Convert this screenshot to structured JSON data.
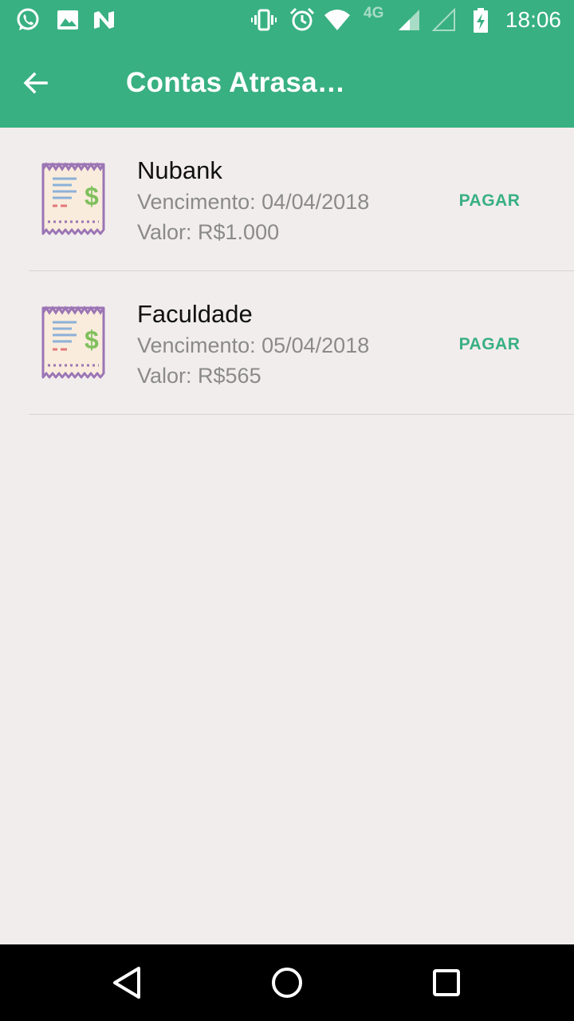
{
  "status_bar": {
    "network": "4G",
    "time": "18:06",
    "icons": [
      "whatsapp-icon",
      "gallery-icon",
      "n-app-icon",
      "vibrate-icon",
      "alarm-icon",
      "wifi-icon",
      "signal-icon",
      "signal-icon",
      "battery-charging-icon"
    ]
  },
  "app_bar": {
    "title": "Contas Atrasa…",
    "back_icon": "arrow-back-icon"
  },
  "bills": [
    {
      "name": "Nubank",
      "due": "Vencimento: 04/04/2018",
      "value": "Valor: R$1.000",
      "action": "PAGAR"
    },
    {
      "name": "Faculdade",
      "due": "Vencimento: 05/04/2018",
      "value": "Valor: R$565",
      "action": "PAGAR"
    }
  ],
  "colors": {
    "primary": "#38b082",
    "background": "#f2eded",
    "secondary_text": "#8a8a8a"
  },
  "nav_bar": {
    "icons": [
      "back-triangle-icon",
      "home-circle-icon",
      "recents-square-icon"
    ]
  }
}
